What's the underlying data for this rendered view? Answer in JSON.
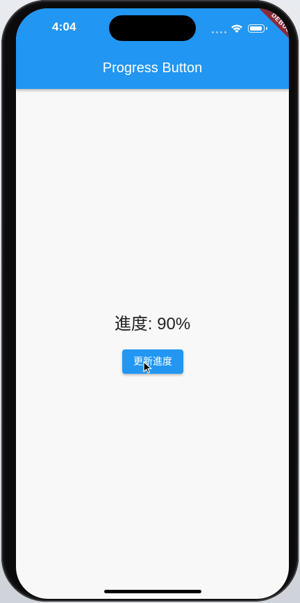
{
  "status_bar": {
    "time": "4:04",
    "signal_icon": "cellular-signal-icon",
    "wifi_icon": "wifi-icon",
    "battery_icon": "battery-icon",
    "battery_level": 0.9
  },
  "debug_banner": {
    "label": "DEBUG",
    "color": "#8a2b3a"
  },
  "app_bar": {
    "title": "Progress Button",
    "background_color": "#2196f3"
  },
  "content": {
    "progress_text": "進度: 90%",
    "update_button_label": "更新進度",
    "button_color": "#2196f3",
    "screen_background": "#f8f8f8"
  }
}
